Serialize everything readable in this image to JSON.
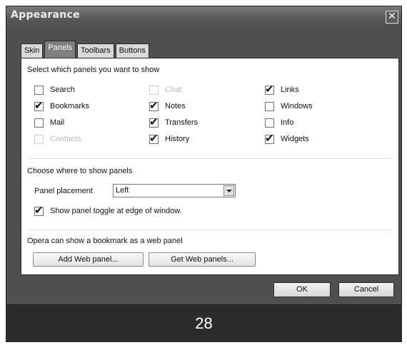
{
  "window": {
    "title": "Appearance",
    "close_glyph": "✕"
  },
  "tabs": [
    {
      "label": "Skin",
      "active": false
    },
    {
      "label": "Panels",
      "active": true
    },
    {
      "label": "Toolbars",
      "active": false
    },
    {
      "label": "Buttons",
      "active": false
    }
  ],
  "panels_section": {
    "heading": "Select which panels you want to show",
    "checkboxes": [
      {
        "label": "Search",
        "checked": false,
        "enabled": true
      },
      {
        "label": "Bookmarks",
        "checked": true,
        "enabled": true
      },
      {
        "label": "Mail",
        "checked": false,
        "enabled": true
      },
      {
        "label": "Contacts",
        "checked": false,
        "enabled": false
      },
      {
        "label": "Chat",
        "checked": false,
        "enabled": false
      },
      {
        "label": "Notes",
        "checked": true,
        "enabled": true
      },
      {
        "label": "Transfers",
        "checked": true,
        "enabled": true
      },
      {
        "label": "History",
        "checked": true,
        "enabled": true
      },
      {
        "label": "Links",
        "checked": true,
        "enabled": true
      },
      {
        "label": "Windows",
        "checked": false,
        "enabled": true
      },
      {
        "label": "Info",
        "checked": false,
        "enabled": true
      },
      {
        "label": "Widgets",
        "checked": true,
        "enabled": true
      }
    ]
  },
  "placement_section": {
    "heading": "Choose where to show panels",
    "placement_label": "Panel placement",
    "placement_value": "Left",
    "toggle_label": "Show panel toggle at edge of window.",
    "toggle_checked": true
  },
  "web_panel_section": {
    "heading": "Opera can show a bookmark as a web panel",
    "add_button": "Add Web panel...",
    "get_button": "Get Web panels..."
  },
  "footer": {
    "ok": "OK",
    "cancel": "Cancel"
  },
  "page_number": "28",
  "icons": {
    "check": "check-icon",
    "close": "close-icon",
    "dropdown": "chevron-down-icon"
  }
}
